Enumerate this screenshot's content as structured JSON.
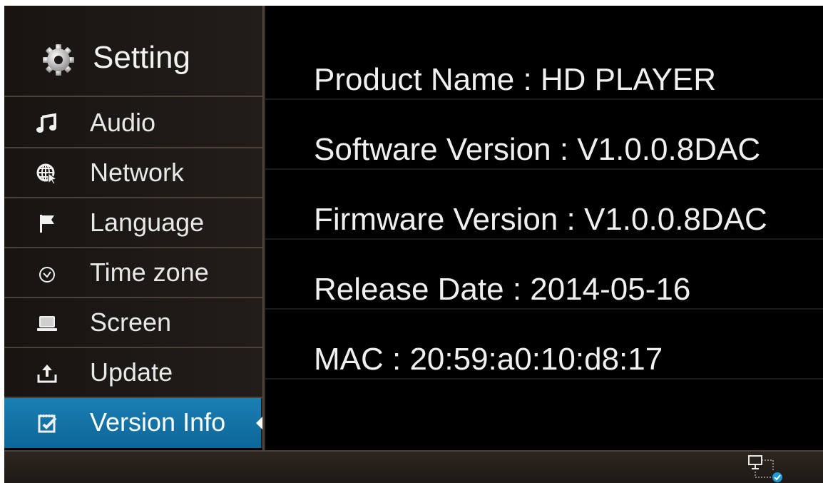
{
  "sidebar": {
    "header": {
      "icon": "gear-icon",
      "title": "Setting"
    },
    "items": [
      {
        "label": "Audio",
        "icon": "music-note-icon",
        "active": false
      },
      {
        "label": "Network",
        "icon": "globe-network-icon",
        "active": false
      },
      {
        "label": "Language",
        "icon": "flag-icon",
        "active": false
      },
      {
        "label": "Time zone",
        "icon": "clock-icon",
        "active": false
      },
      {
        "label": "Screen",
        "icon": "laptop-screen-icon",
        "active": false
      },
      {
        "label": "Update",
        "icon": "upload-icon",
        "active": false
      },
      {
        "label": "Version Info",
        "icon": "notepad-check-icon",
        "active": true
      }
    ]
  },
  "info": {
    "rows": [
      {
        "text": "Product Name : HD PLAYER"
      },
      {
        "text": "Software Version : V1.0.0.8DAC"
      },
      {
        "text": "Firmware Version : V1.0.0.8DAC"
      },
      {
        "text": "Release Date : 2014-05-16"
      },
      {
        "text": "MAC : 20:59:a0:10:d8:17"
      }
    ]
  },
  "footer": {
    "status_icon": "network-connected-icon"
  },
  "colors": {
    "accent": "#1a7fb2",
    "background": "#000000",
    "sidebar": "#1e1a17",
    "text": "#f0f0f0"
  }
}
